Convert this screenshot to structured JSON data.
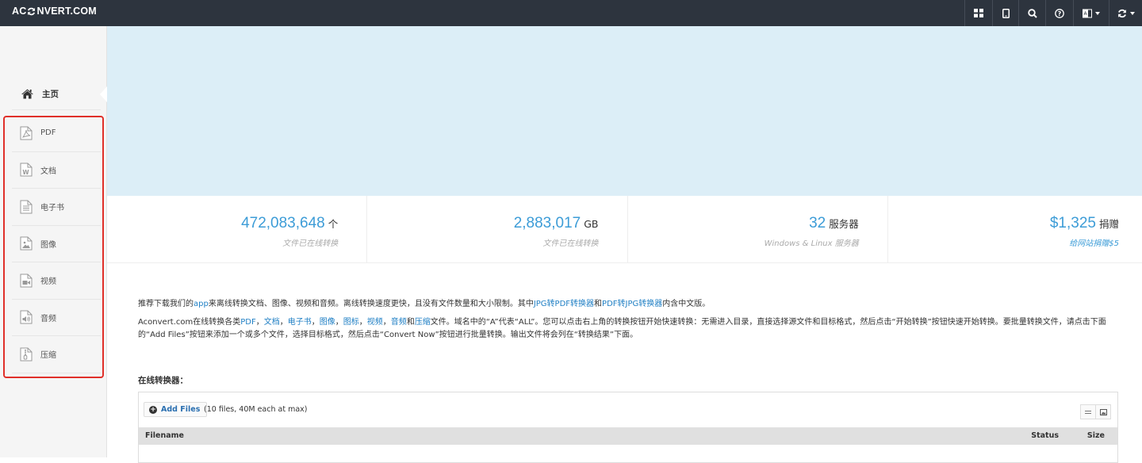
{
  "topbar": {
    "logo_left": "AC",
    "logo_right": "NVERT.COM",
    "buttons": [
      "grid-icon",
      "tablet-icon",
      "search-icon",
      "help-icon",
      "language-icon",
      "refresh-icon"
    ]
  },
  "sidebar": {
    "home_label": "主页",
    "items": [
      {
        "label": "PDF",
        "icon": "pdf-icon"
      },
      {
        "label": "文档",
        "icon": "word-icon"
      },
      {
        "label": "电子书",
        "icon": "ebook-icon"
      },
      {
        "label": "图像",
        "icon": "image-icon"
      },
      {
        "label": "视频",
        "icon": "video-icon"
      },
      {
        "label": "音频",
        "icon": "audio-icon"
      },
      {
        "label": "压缩",
        "icon": "archive-icon"
      }
    ]
  },
  "stats": [
    {
      "value": "472,083,648",
      "unit": "个",
      "sub": "文件已在线转换"
    },
    {
      "value": "2,883,017",
      "unit": "GB",
      "sub": "文件已在线转换"
    },
    {
      "value": "32",
      "unit": "服务器",
      "sub": "Windows & Linux 服务器"
    },
    {
      "value": "$1,325",
      "unit": "捐赠",
      "sub": "给网站捐赠$5"
    }
  ],
  "intro": {
    "p1_a": "推荐下载我们的",
    "p1_app": "app",
    "p1_b": "来离线转换文档、图像、视频和音频。离线转换速度更快，且没有文件数量和大小限制。其中",
    "p1_link1": "JPG转PDF转换器",
    "p1_c": "和",
    "p1_link2": "PDF转JPG转换器",
    "p1_d": "内含中文版。",
    "p2_a": "Aconvert.com在线转换各类",
    "p2_pdf": "PDF",
    "sep": "，",
    "p2_doc": "文档",
    "p2_ebook": "电子书",
    "p2_image": "图像",
    "p2_icon": "图标",
    "p2_video": "视频",
    "p2_audio": "音频",
    "p2_and": "和",
    "p2_archive": "压缩",
    "p2_b": "文件。域名中的“A”代表“ALL”。您可以点击右上角的转换按钮开始快速转换：无需进入目录，直接选择源文件和目标格式，然后点击“开始转换”按钮快速开始转换。要批量转换文件，请点击下面的“Add Files”按钮来添加一个或多个文件，选择目标格式，然后点击“Convert Now”按钮进行批量转换。输出文件将会列在“转换结果”下面。"
  },
  "converter": {
    "title": "在线转换器：",
    "add_files_label": "Add Files",
    "limit_text": "(10 files, 40M each at max)",
    "columns": {
      "filename": "Filename",
      "status": "Status",
      "size": "Size"
    }
  }
}
